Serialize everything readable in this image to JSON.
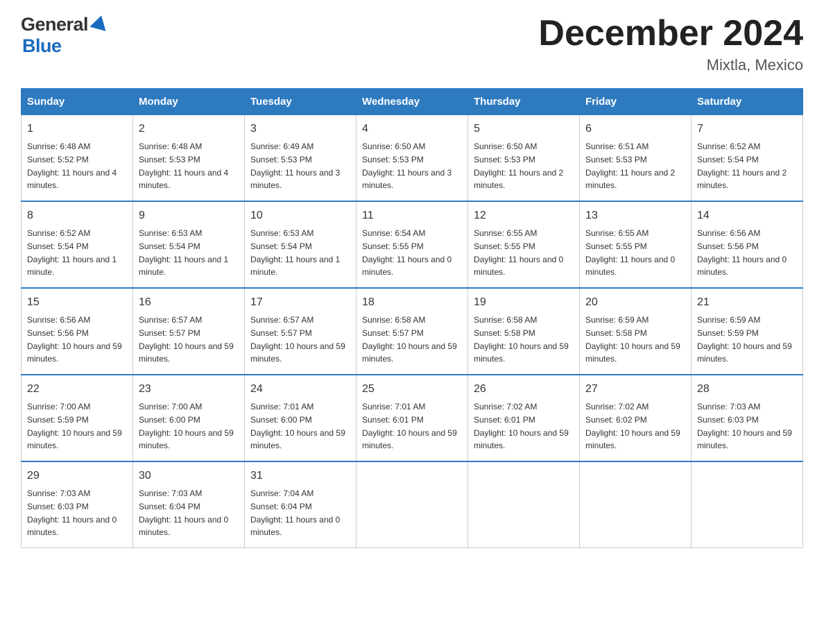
{
  "header": {
    "logo_text_general": "General",
    "logo_text_blue": "Blue",
    "calendar_title": "December 2024",
    "calendar_subtitle": "Mixtla, Mexico"
  },
  "weekdays": [
    "Sunday",
    "Monday",
    "Tuesday",
    "Wednesday",
    "Thursday",
    "Friday",
    "Saturday"
  ],
  "weeks": [
    [
      {
        "day": "1",
        "sunrise": "6:48 AM",
        "sunset": "5:52 PM",
        "daylight": "11 hours and 4 minutes."
      },
      {
        "day": "2",
        "sunrise": "6:48 AM",
        "sunset": "5:53 PM",
        "daylight": "11 hours and 4 minutes."
      },
      {
        "day": "3",
        "sunrise": "6:49 AM",
        "sunset": "5:53 PM",
        "daylight": "11 hours and 3 minutes."
      },
      {
        "day": "4",
        "sunrise": "6:50 AM",
        "sunset": "5:53 PM",
        "daylight": "11 hours and 3 minutes."
      },
      {
        "day": "5",
        "sunrise": "6:50 AM",
        "sunset": "5:53 PM",
        "daylight": "11 hours and 2 minutes."
      },
      {
        "day": "6",
        "sunrise": "6:51 AM",
        "sunset": "5:53 PM",
        "daylight": "11 hours and 2 minutes."
      },
      {
        "day": "7",
        "sunrise": "6:52 AM",
        "sunset": "5:54 PM",
        "daylight": "11 hours and 2 minutes."
      }
    ],
    [
      {
        "day": "8",
        "sunrise": "6:52 AM",
        "sunset": "5:54 PM",
        "daylight": "11 hours and 1 minute."
      },
      {
        "day": "9",
        "sunrise": "6:53 AM",
        "sunset": "5:54 PM",
        "daylight": "11 hours and 1 minute."
      },
      {
        "day": "10",
        "sunrise": "6:53 AM",
        "sunset": "5:54 PM",
        "daylight": "11 hours and 1 minute."
      },
      {
        "day": "11",
        "sunrise": "6:54 AM",
        "sunset": "5:55 PM",
        "daylight": "11 hours and 0 minutes."
      },
      {
        "day": "12",
        "sunrise": "6:55 AM",
        "sunset": "5:55 PM",
        "daylight": "11 hours and 0 minutes."
      },
      {
        "day": "13",
        "sunrise": "6:55 AM",
        "sunset": "5:55 PM",
        "daylight": "11 hours and 0 minutes."
      },
      {
        "day": "14",
        "sunrise": "6:56 AM",
        "sunset": "5:56 PM",
        "daylight": "11 hours and 0 minutes."
      }
    ],
    [
      {
        "day": "15",
        "sunrise": "6:56 AM",
        "sunset": "5:56 PM",
        "daylight": "10 hours and 59 minutes."
      },
      {
        "day": "16",
        "sunrise": "6:57 AM",
        "sunset": "5:57 PM",
        "daylight": "10 hours and 59 minutes."
      },
      {
        "day": "17",
        "sunrise": "6:57 AM",
        "sunset": "5:57 PM",
        "daylight": "10 hours and 59 minutes."
      },
      {
        "day": "18",
        "sunrise": "6:58 AM",
        "sunset": "5:57 PM",
        "daylight": "10 hours and 59 minutes."
      },
      {
        "day": "19",
        "sunrise": "6:58 AM",
        "sunset": "5:58 PM",
        "daylight": "10 hours and 59 minutes."
      },
      {
        "day": "20",
        "sunrise": "6:59 AM",
        "sunset": "5:58 PM",
        "daylight": "10 hours and 59 minutes."
      },
      {
        "day": "21",
        "sunrise": "6:59 AM",
        "sunset": "5:59 PM",
        "daylight": "10 hours and 59 minutes."
      }
    ],
    [
      {
        "day": "22",
        "sunrise": "7:00 AM",
        "sunset": "5:59 PM",
        "daylight": "10 hours and 59 minutes."
      },
      {
        "day": "23",
        "sunrise": "7:00 AM",
        "sunset": "6:00 PM",
        "daylight": "10 hours and 59 minutes."
      },
      {
        "day": "24",
        "sunrise": "7:01 AM",
        "sunset": "6:00 PM",
        "daylight": "10 hours and 59 minutes."
      },
      {
        "day": "25",
        "sunrise": "7:01 AM",
        "sunset": "6:01 PM",
        "daylight": "10 hours and 59 minutes."
      },
      {
        "day": "26",
        "sunrise": "7:02 AM",
        "sunset": "6:01 PM",
        "daylight": "10 hours and 59 minutes."
      },
      {
        "day": "27",
        "sunrise": "7:02 AM",
        "sunset": "6:02 PM",
        "daylight": "10 hours and 59 minutes."
      },
      {
        "day": "28",
        "sunrise": "7:03 AM",
        "sunset": "6:03 PM",
        "daylight": "10 hours and 59 minutes."
      }
    ],
    [
      {
        "day": "29",
        "sunrise": "7:03 AM",
        "sunset": "6:03 PM",
        "daylight": "11 hours and 0 minutes."
      },
      {
        "day": "30",
        "sunrise": "7:03 AM",
        "sunset": "6:04 PM",
        "daylight": "11 hours and 0 minutes."
      },
      {
        "day": "31",
        "sunrise": "7:04 AM",
        "sunset": "6:04 PM",
        "daylight": "11 hours and 0 minutes."
      },
      null,
      null,
      null,
      null
    ]
  ]
}
